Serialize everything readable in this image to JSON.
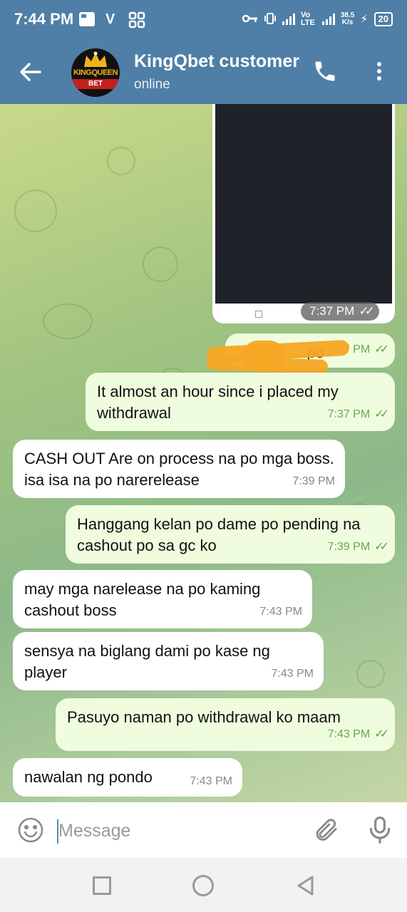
{
  "status_bar": {
    "time": "7:44 PM",
    "network": "Vo LTE",
    "speed_value": "38.5",
    "speed_unit": "K/s",
    "battery": "20"
  },
  "header": {
    "title": "KingQbet customer service",
    "status": "online",
    "avatar_logo": "KINGQUEEN",
    "avatar_sub": "BET"
  },
  "messages": [
    {
      "type": "image",
      "time": "7:37 PM"
    },
    {
      "type": "out",
      "text": "...po",
      "time": "7:37 PM"
    },
    {
      "type": "out",
      "text": "It almost an hour since i placed my withdrawal",
      "time": "7:37 PM"
    },
    {
      "type": "in",
      "text": "CASH OUT Are on process na po mga boss. isa isa na po narerelease",
      "time": "7:39 PM"
    },
    {
      "type": "out",
      "text": "Hanggang kelan po dame po pending na cashout po sa gc ko",
      "time": "7:39 PM"
    },
    {
      "type": "in",
      "text": "may mga narelease na po kaming cashout boss",
      "time": "7:43 PM"
    },
    {
      "type": "in",
      "text": "sensya na biglang dami po kase ng player",
      "time": "7:43 PM"
    },
    {
      "type": "out",
      "text": "Pasuyo naman po withdrawal ko maam",
      "time": "7:43 PM"
    },
    {
      "type": "in",
      "text": "nawalan ng pondo",
      "time": "7:43 PM"
    }
  ],
  "input": {
    "placeholder": "Message"
  },
  "icons": {
    "back": "arrow-left-icon",
    "call": "phone-icon",
    "menu": "more-vertical-icon",
    "emoji": "smiley-icon",
    "attach": "paperclip-icon",
    "mic": "microphone-icon"
  },
  "colors": {
    "header_bg": "#4f7fa6",
    "bubble_out": "#effdde",
    "bubble_in": "#ffffff",
    "check_green": "#5aa44a"
  }
}
